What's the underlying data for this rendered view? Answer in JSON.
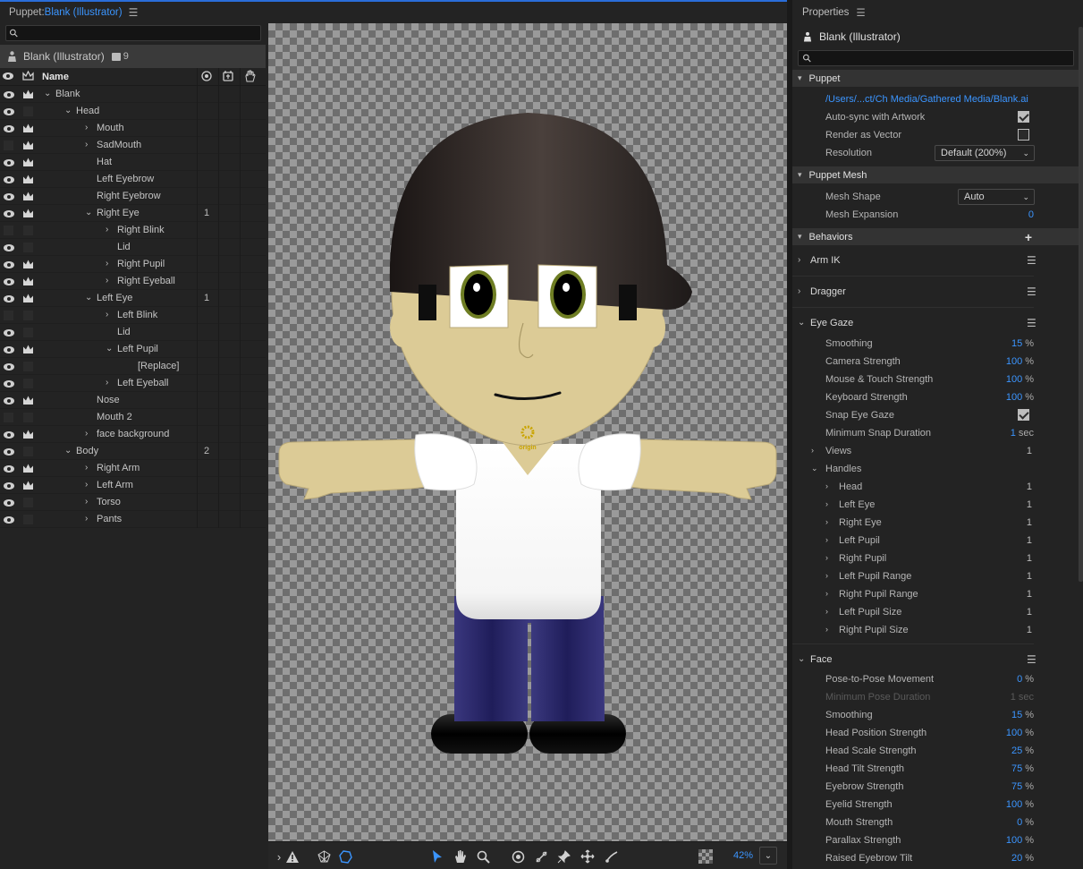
{
  "puppet_panel": {
    "title_prefix": "Puppet: ",
    "title_name": "Blank (Illustrator)",
    "puppet_name": "Blank (Illustrator)",
    "layer_count": "9",
    "columns": {
      "name": "Name"
    },
    "rows": [
      {
        "label": "Blank",
        "eye": true,
        "crown": true,
        "indent": 0,
        "chev": "v",
        "count": ""
      },
      {
        "label": "Head",
        "eye": true,
        "crown": false,
        "indent": 1,
        "chev": "v",
        "count": ""
      },
      {
        "label": "Mouth",
        "eye": true,
        "crown": true,
        "indent": 2,
        "chev": ">",
        "count": ""
      },
      {
        "label": "SadMouth",
        "eye": false,
        "crown": true,
        "indent": 2,
        "chev": ">",
        "count": ""
      },
      {
        "label": "Hat",
        "eye": true,
        "crown": true,
        "indent": 2,
        "chev": "",
        "count": ""
      },
      {
        "label": "Left Eyebrow",
        "eye": true,
        "crown": true,
        "indent": 2,
        "chev": "",
        "count": ""
      },
      {
        "label": "Right Eyebrow",
        "eye": true,
        "crown": true,
        "indent": 2,
        "chev": "",
        "count": ""
      },
      {
        "label": "Right Eye",
        "eye": true,
        "crown": true,
        "indent": 2,
        "chev": "v",
        "count": "1"
      },
      {
        "label": "Right Blink",
        "eye": false,
        "crown": false,
        "indent": 3,
        "chev": ">",
        "count": ""
      },
      {
        "label": "Lid",
        "eye": true,
        "crown": false,
        "indent": 3,
        "chev": "",
        "count": ""
      },
      {
        "label": "Right Pupil",
        "eye": true,
        "crown": true,
        "indent": 3,
        "chev": ">",
        "count": ""
      },
      {
        "label": "Right Eyeball",
        "eye": true,
        "crown": true,
        "indent": 3,
        "chev": ">",
        "count": ""
      },
      {
        "label": "Left Eye",
        "eye": true,
        "crown": true,
        "indent": 2,
        "chev": "v",
        "count": "1"
      },
      {
        "label": "Left Blink",
        "eye": false,
        "crown": false,
        "indent": 3,
        "chev": ">",
        "count": ""
      },
      {
        "label": "Lid",
        "eye": true,
        "crown": false,
        "indent": 3,
        "chev": "",
        "count": ""
      },
      {
        "label": "Left Pupil",
        "eye": true,
        "crown": true,
        "indent": 3,
        "chev": "v",
        "count": ""
      },
      {
        "label": "[Replace]",
        "eye": true,
        "crown": false,
        "indent": 4,
        "chev": "",
        "count": ""
      },
      {
        "label": "Left Eyeball",
        "eye": true,
        "crown": false,
        "indent": 3,
        "chev": ">",
        "count": ""
      },
      {
        "label": "Nose",
        "eye": true,
        "crown": true,
        "indent": 2,
        "chev": "",
        "count": ""
      },
      {
        "label": "Mouth 2",
        "eye": false,
        "crown": false,
        "indent": 2,
        "chev": "",
        "count": ""
      },
      {
        "label": "face background",
        "eye": true,
        "crown": true,
        "indent": 2,
        "chev": ">",
        "count": ""
      },
      {
        "label": "Body",
        "eye": true,
        "crown": false,
        "indent": 1,
        "chev": "v",
        "count": "2"
      },
      {
        "label": "Right Arm",
        "eye": true,
        "crown": true,
        "indent": 2,
        "chev": ">",
        "count": ""
      },
      {
        "label": "Left Arm",
        "eye": true,
        "crown": true,
        "indent": 2,
        "chev": ">",
        "count": ""
      },
      {
        "label": "Torso",
        "eye": true,
        "crown": false,
        "indent": 2,
        "chev": ">",
        "count": ""
      },
      {
        "label": "Pants",
        "eye": true,
        "crown": false,
        "indent": 2,
        "chev": ">",
        "count": ""
      }
    ]
  },
  "stage": {
    "origin_label": "origin"
  },
  "toolbar": {
    "zoom": "42%"
  },
  "properties": {
    "header": "Properties",
    "puppet_name": "Blank (Illustrator)",
    "puppet_section": {
      "title": "Puppet",
      "path": "/Users/...ct/Ch Media/Gathered Media/Blank.ai",
      "auto_sync_label": "Auto-sync with Artwork",
      "render_vector_label": "Render as Vector",
      "resolution_label": "Resolution",
      "resolution_value": "Default (200%)"
    },
    "mesh_section": {
      "title": "Puppet Mesh",
      "shape_label": "Mesh Shape",
      "shape_value": "Auto",
      "expansion_label": "Mesh Expansion",
      "expansion_value": "0"
    },
    "behaviors_section": {
      "title": "Behaviors",
      "arm_ik": "Arm IK",
      "dragger": "Dragger",
      "eye_gaze": "Eye Gaze",
      "eye_gaze_params": [
        {
          "label": "Smoothing",
          "value": "15",
          "unit": "%"
        },
        {
          "label": "Camera Strength",
          "value": "100",
          "unit": "%"
        },
        {
          "label": "Mouse & Touch Strength",
          "value": "100",
          "unit": "%"
        },
        {
          "label": "Keyboard Strength",
          "value": "100",
          "unit": "%"
        }
      ],
      "snap_label": "Snap Eye Gaze",
      "min_snap_label": "Minimum Snap Duration",
      "min_snap_value": "1",
      "min_snap_unit": "sec",
      "views_label": "Views",
      "views_count": "1",
      "handles_label": "Handles",
      "handles": [
        {
          "label": "Head",
          "count": "1"
        },
        {
          "label": "Left Eye",
          "count": "1"
        },
        {
          "label": "Right Eye",
          "count": "1"
        },
        {
          "label": "Left Pupil",
          "count": "1"
        },
        {
          "label": "Right Pupil",
          "count": "1"
        },
        {
          "label": "Left Pupil Range",
          "count": "1"
        },
        {
          "label": "Right Pupil Range",
          "count": "1"
        },
        {
          "label": "Left Pupil Size",
          "count": "1"
        },
        {
          "label": "Right Pupil Size",
          "count": "1"
        }
      ],
      "face": "Face",
      "face_params": [
        {
          "label": "Pose-to-Pose Movement",
          "value": "0",
          "unit": "%",
          "dim": false
        },
        {
          "label": "Minimum Pose Duration",
          "value": "1",
          "unit": "sec",
          "dim": true
        },
        {
          "label": "Smoothing",
          "value": "15",
          "unit": "%",
          "dim": false
        },
        {
          "label": "Head Position Strength",
          "value": "100",
          "unit": "%",
          "dim": false
        },
        {
          "label": "Head Scale Strength",
          "value": "25",
          "unit": "%",
          "dim": false
        },
        {
          "label": "Head Tilt Strength",
          "value": "75",
          "unit": "%",
          "dim": false
        },
        {
          "label": "Eyebrow Strength",
          "value": "75",
          "unit": "%",
          "dim": false
        },
        {
          "label": "Eyelid Strength",
          "value": "100",
          "unit": "%",
          "dim": false
        },
        {
          "label": "Mouth Strength",
          "value": "0",
          "unit": "%",
          "dim": false
        },
        {
          "label": "Parallax Strength",
          "value": "100",
          "unit": "%",
          "dim": false
        },
        {
          "label": "Raised Eyebrow Tilt",
          "value": "20",
          "unit": "%",
          "dim": false
        }
      ]
    }
  },
  "colors": {
    "accent": "#3b95ff",
    "skin": "#dccb96",
    "hat": "#2e2725",
    "shirt": "#ffffff",
    "pants": "#2d2a6e",
    "shoes": "#0a0a0a",
    "iris": "#6e7d23"
  }
}
